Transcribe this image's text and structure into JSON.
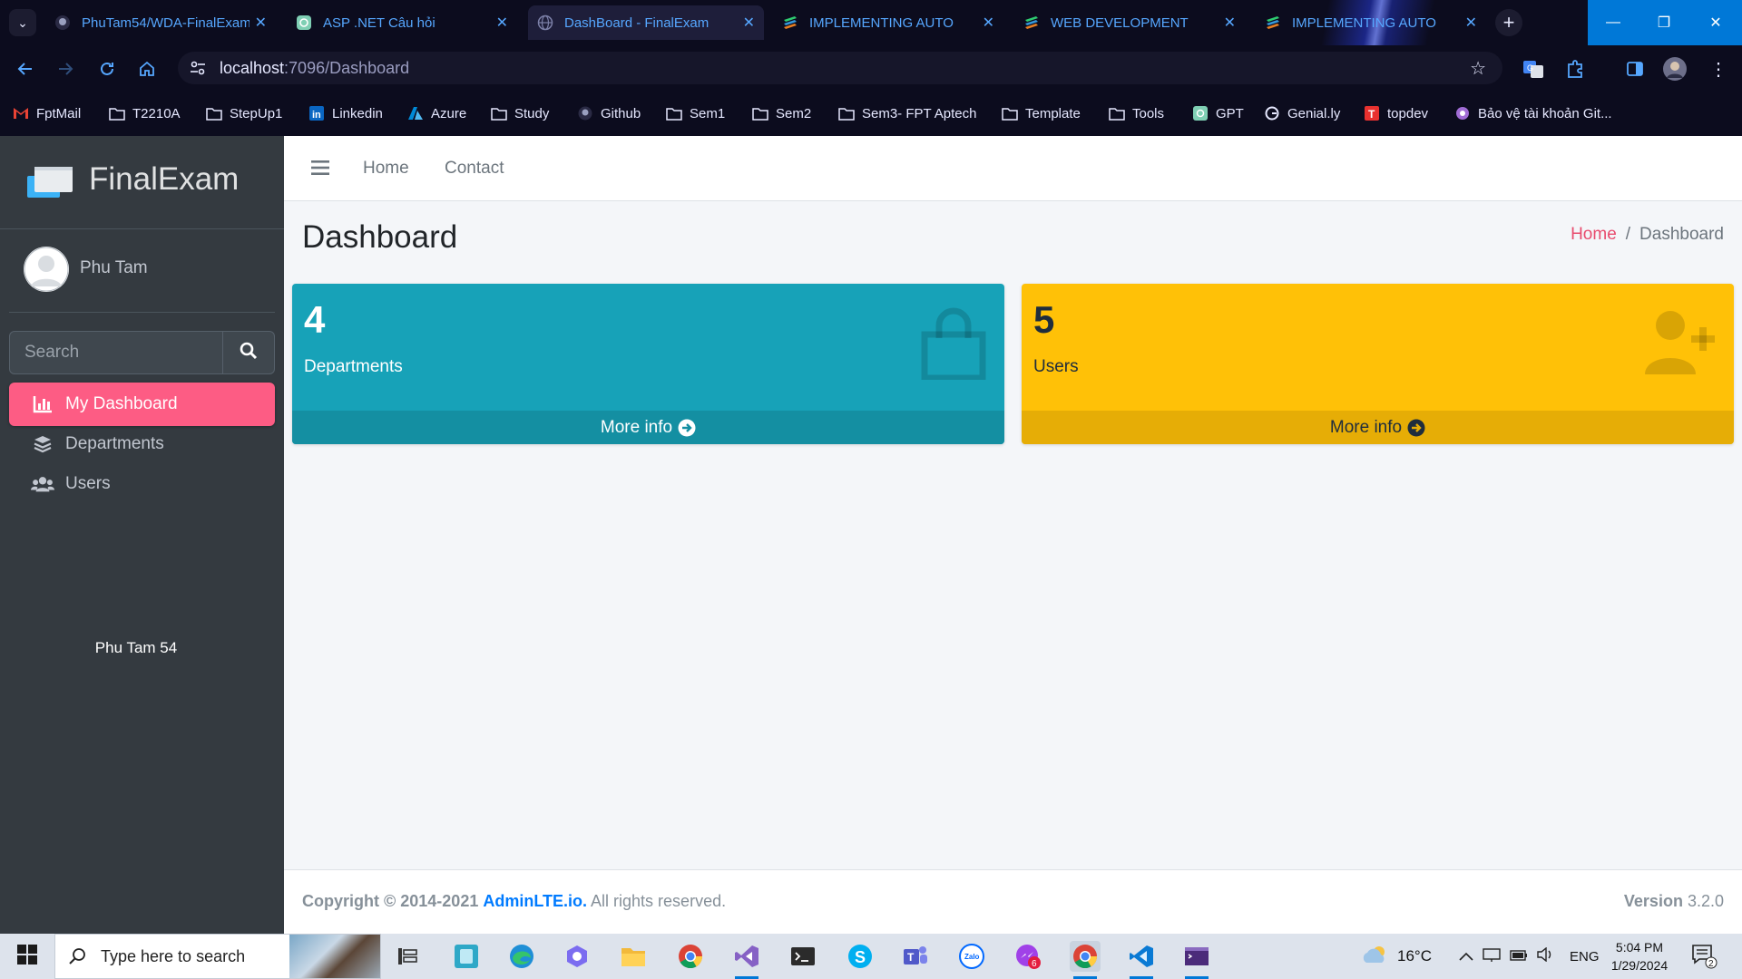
{
  "browser": {
    "tabs": [
      {
        "title": "PhuTam54/WDA-FinalExam",
        "icon": "github-icon"
      },
      {
        "title": "ASP .NET Câu hỏi",
        "icon": "chatgpt-icon"
      },
      {
        "title": "DashBoard - FinalExam",
        "icon": "globe-icon",
        "active": true
      },
      {
        "title": "IMPLEMENTING AUTO",
        "icon": "stack-icon"
      },
      {
        "title": "WEB DEVELOPMENT",
        "icon": "stack-icon"
      },
      {
        "title": "IMPLEMENTING AUTO",
        "icon": "stack-icon"
      }
    ],
    "url_host": "localhost",
    "url_path": ":7096/Dashboard",
    "bookmarks": [
      {
        "label": "FptMail",
        "icon": "gmail-icon"
      },
      {
        "label": "T2210A",
        "icon": "folder-icon"
      },
      {
        "label": "StepUp1",
        "icon": "folder-icon"
      },
      {
        "label": "Linkedin",
        "icon": "linkedin-icon"
      },
      {
        "label": "Azure",
        "icon": "azure-icon"
      },
      {
        "label": "Study",
        "icon": "folder-icon"
      },
      {
        "label": "Github",
        "icon": "github-icon"
      },
      {
        "label": "Sem1",
        "icon": "folder-icon"
      },
      {
        "label": "Sem2",
        "icon": "folder-icon"
      },
      {
        "label": "Sem3- FPT Aptech",
        "icon": "folder-icon"
      },
      {
        "label": "Template",
        "icon": "folder-icon"
      },
      {
        "label": "Tools",
        "icon": "folder-icon"
      },
      {
        "label": "GPT",
        "icon": "chatgpt-icon"
      },
      {
        "label": "Genial.ly",
        "icon": "genially-icon"
      },
      {
        "label": "topdev",
        "icon": "topdev-icon"
      },
      {
        "label": "Bảo vệ tài khoản Git...",
        "icon": "shield-icon"
      }
    ]
  },
  "sidebar": {
    "brand": "FinalExam",
    "user_name": "Phu Tam",
    "search_placeholder": "Search",
    "menu": [
      {
        "label": "My Dashboard",
        "icon": "chart-bar-icon",
        "active": true
      },
      {
        "label": "Departments",
        "icon": "layers-icon"
      },
      {
        "label": "Users",
        "icon": "users-icon"
      }
    ],
    "footer_text": "Phu Tam 54"
  },
  "topnav": {
    "links": [
      "Home",
      "Contact"
    ]
  },
  "header": {
    "title": "Dashboard",
    "breadcrumb_home": "Home",
    "breadcrumb_sep": "/",
    "breadcrumb_current": "Dashboard"
  },
  "cards": [
    {
      "value": "4",
      "label": "Departments",
      "more": "More info",
      "icon": "shopping-bag-icon",
      "color": "#17a2b8"
    },
    {
      "value": "5",
      "label": "Users",
      "more": "More info",
      "icon": "user-plus-icon",
      "color": "#ffc107"
    }
  ],
  "footer": {
    "copyright_prefix": "Copyright © 2014-2021",
    "brand_link": "AdminLTE.io.",
    "rights": "All rights reserved.",
    "version_label": "Version",
    "version": "3.2.0"
  },
  "taskbar": {
    "search_placeholder": "Type here to search",
    "weather": "16°C",
    "language": "ENG",
    "time": "5:04 PM",
    "date": "1/29/2024",
    "notification_count": "2",
    "messenger_badge": "6"
  },
  "colors": {
    "accent": "#fd5c84",
    "info": "#17a2b8",
    "warning": "#ffc107",
    "sidebar_bg": "#343a40"
  }
}
